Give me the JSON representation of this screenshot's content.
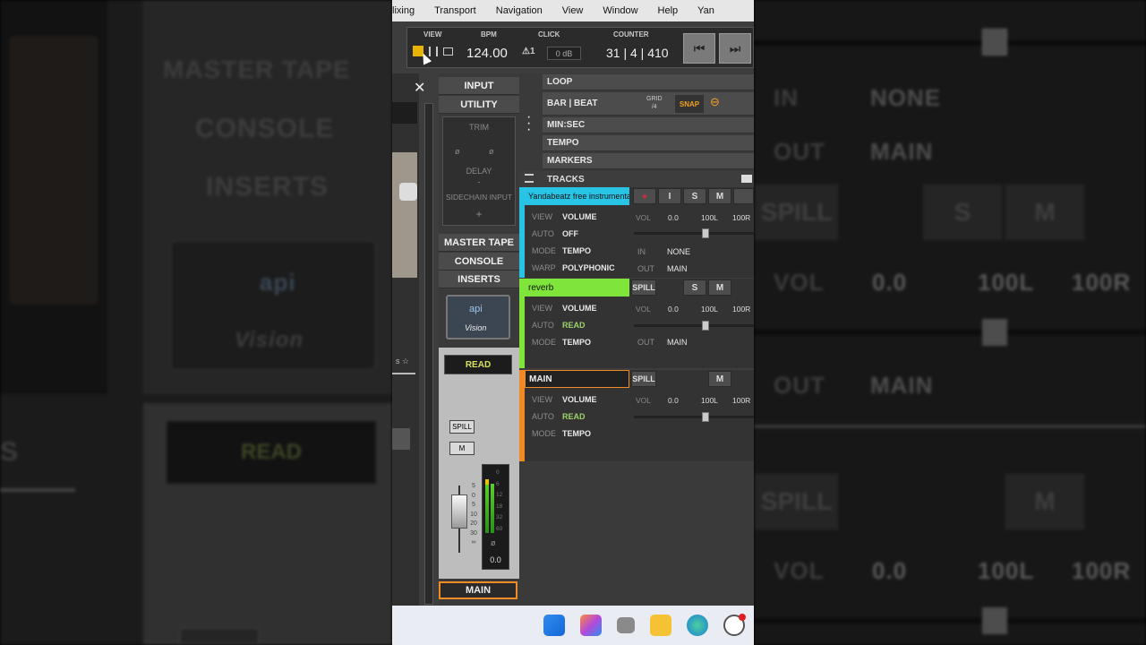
{
  "menu": [
    "lixing",
    "Transport",
    "Navigation",
    "View",
    "Window",
    "Help",
    "Yan"
  ],
  "transport": {
    "view_label": "VIEW",
    "bpm_label": "BPM",
    "bpm": "124.00",
    "click_label": "CLICK",
    "click_db": "0 dB",
    "counter_label": "COUNTER",
    "counter": "31 | 4 | 410"
  },
  "left_strip": {
    "input": "INPUT",
    "utility": "UTILITY",
    "trim": "TRIM",
    "delay": "DELAY",
    "delay_value": "-",
    "sidechain": "SIDECHAIN INPUT",
    "master_tape": "MASTER TAPE",
    "console": "CONSOLE",
    "inserts": "INSERTS",
    "plugin_brand": "api",
    "plugin_name": "Vision",
    "automation": "READ",
    "spill": "SPILL",
    "mute": "M",
    "meter_scale": [
      "0",
      "6",
      "12",
      "18",
      "32",
      "60"
    ],
    "fader_scale": [
      "5",
      "0",
      "5",
      "10",
      "20",
      "30",
      "∞"
    ],
    "meter_readout": "0.0",
    "channel_name": "MAIN"
  },
  "rulers": [
    "LOOP",
    "BAR | BEAT",
    "MIN:SEC",
    "TEMPO",
    "MARKERS",
    "TRACKS"
  ],
  "grid": {
    "label": "GRID",
    "value": "/4",
    "snap": "SNAP"
  },
  "tracks": [
    {
      "name": "Yandabeatz free instrumental ...",
      "color": "#29c3e6",
      "buttons": [
        "●",
        "I",
        "S",
        "M"
      ],
      "params": [
        {
          "label": "VIEW",
          "value": "VOLUME"
        },
        {
          "label": "AUTO",
          "value": "OFF"
        },
        {
          "label": "MODE",
          "value": "TEMPO"
        },
        {
          "label": "WARP",
          "value": "POLYPHONIC"
        }
      ],
      "vol": "0.0",
      "pan_l": "100L",
      "pan_r": "100R",
      "in_label": "IN",
      "in_value": "NONE",
      "out_label": "OUT",
      "out_value": "MAIN",
      "fader_level": 0.6
    },
    {
      "name": "reverb",
      "color": "#7fe53b",
      "buttons": [
        "SPILL",
        "S",
        "M"
      ],
      "params": [
        {
          "label": "VIEW",
          "value": "VOLUME"
        },
        {
          "label": "AUTO",
          "value": "READ"
        },
        {
          "label": "MODE",
          "value": "TEMPO"
        }
      ],
      "vol": "0.0",
      "pan_l": "100L",
      "pan_r": "100R",
      "out_label": "OUT",
      "out_value": "MAIN",
      "fader_level": 0.6
    },
    {
      "name": "MAIN",
      "color": "#f08a24",
      "buttons": [
        "SPILL",
        "M"
      ],
      "params": [
        {
          "label": "VIEW",
          "value": "VOLUME"
        },
        {
          "label": "AUTO",
          "value": "READ"
        },
        {
          "label": "MODE",
          "value": "TEMPO"
        }
      ],
      "vol": "0.0",
      "pan_l": "100L",
      "pan_r": "100R",
      "fader_level": 0.6
    }
  ],
  "bg_left": {
    "master_tape": "MASTER TAPE",
    "console": "CONSOLE",
    "inserts": "INSERTS",
    "plugin_brand": "api",
    "plugin_name": "Vision",
    "read": "READ",
    "s": "S"
  },
  "bg_right": {
    "in": "IN",
    "in_value": "NONE",
    "out": "OUT",
    "out_value": "MAIN",
    "spill": "SPILL",
    "s": "S",
    "m": "M",
    "vol": "VOL",
    "vol_value": "0.0",
    "pan_l": "100L",
    "pan_r": "100R"
  },
  "taskbar_icons": [
    "windows-start-icon",
    "copilot-icon",
    "task-view-icon",
    "file-explorer-icon",
    "edge-browser-icon",
    "chrome-like-icon"
  ]
}
